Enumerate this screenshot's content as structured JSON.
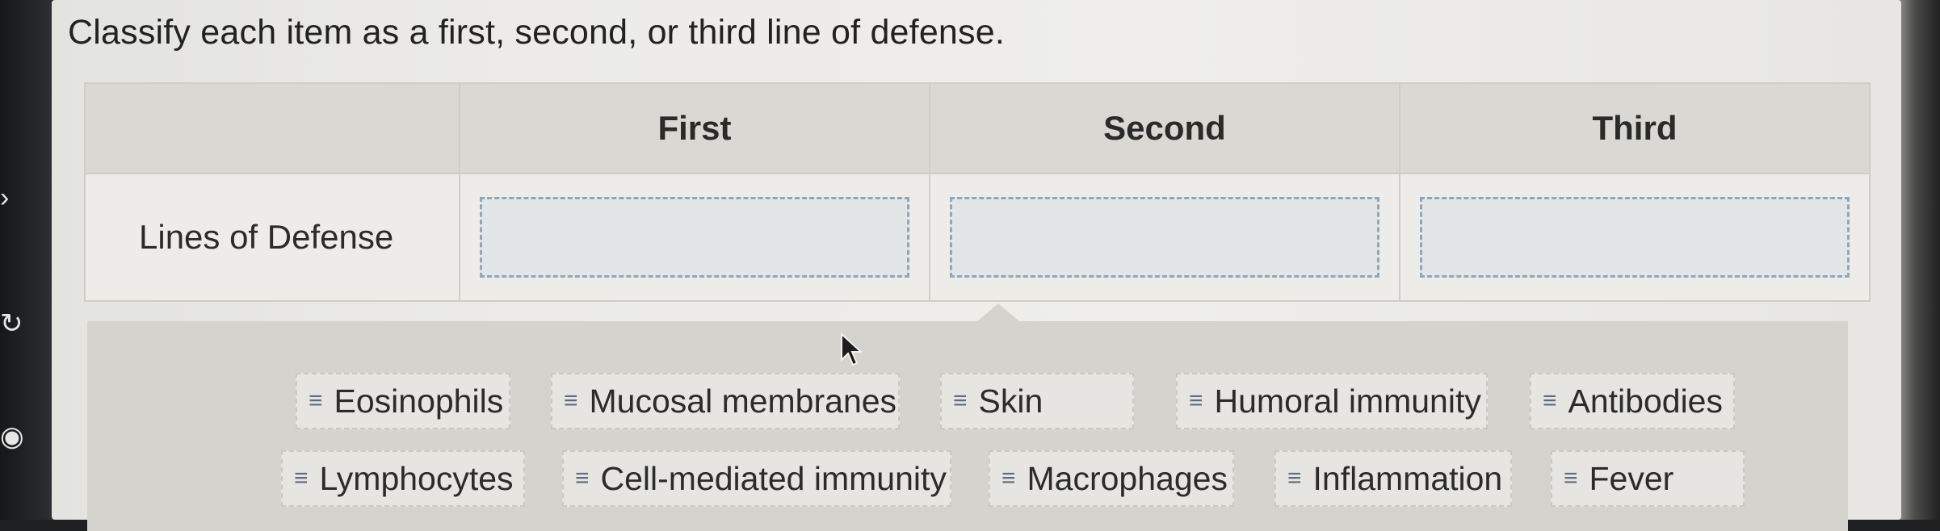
{
  "prompt": "Classify each item as a first, second, or third line of defense.",
  "table": {
    "columns": [
      "First",
      "Second",
      "Third"
    ],
    "row_label": "Lines of Defense"
  },
  "items": [
    {
      "label": "Eosinophils"
    },
    {
      "label": "Mucosal membranes"
    },
    {
      "label": "Skin"
    },
    {
      "label": "Humoral immunity"
    },
    {
      "label": "Antibodies"
    },
    {
      "label": "Lymphocytes"
    },
    {
      "label": "Cell-mediated immunity"
    },
    {
      "label": "Macrophages"
    },
    {
      "label": "Inflammation"
    },
    {
      "label": "Fever"
    }
  ],
  "grip_glyph": "≡",
  "icons": {
    "drag_handle": "grip-lines-icon",
    "pointer": "mouse-pointer-icon"
  },
  "colors": {
    "drop_zone_border": "#8fa7bd",
    "header_bg": "#d9d8d3",
    "pool_bg": "#d4d3ce"
  }
}
